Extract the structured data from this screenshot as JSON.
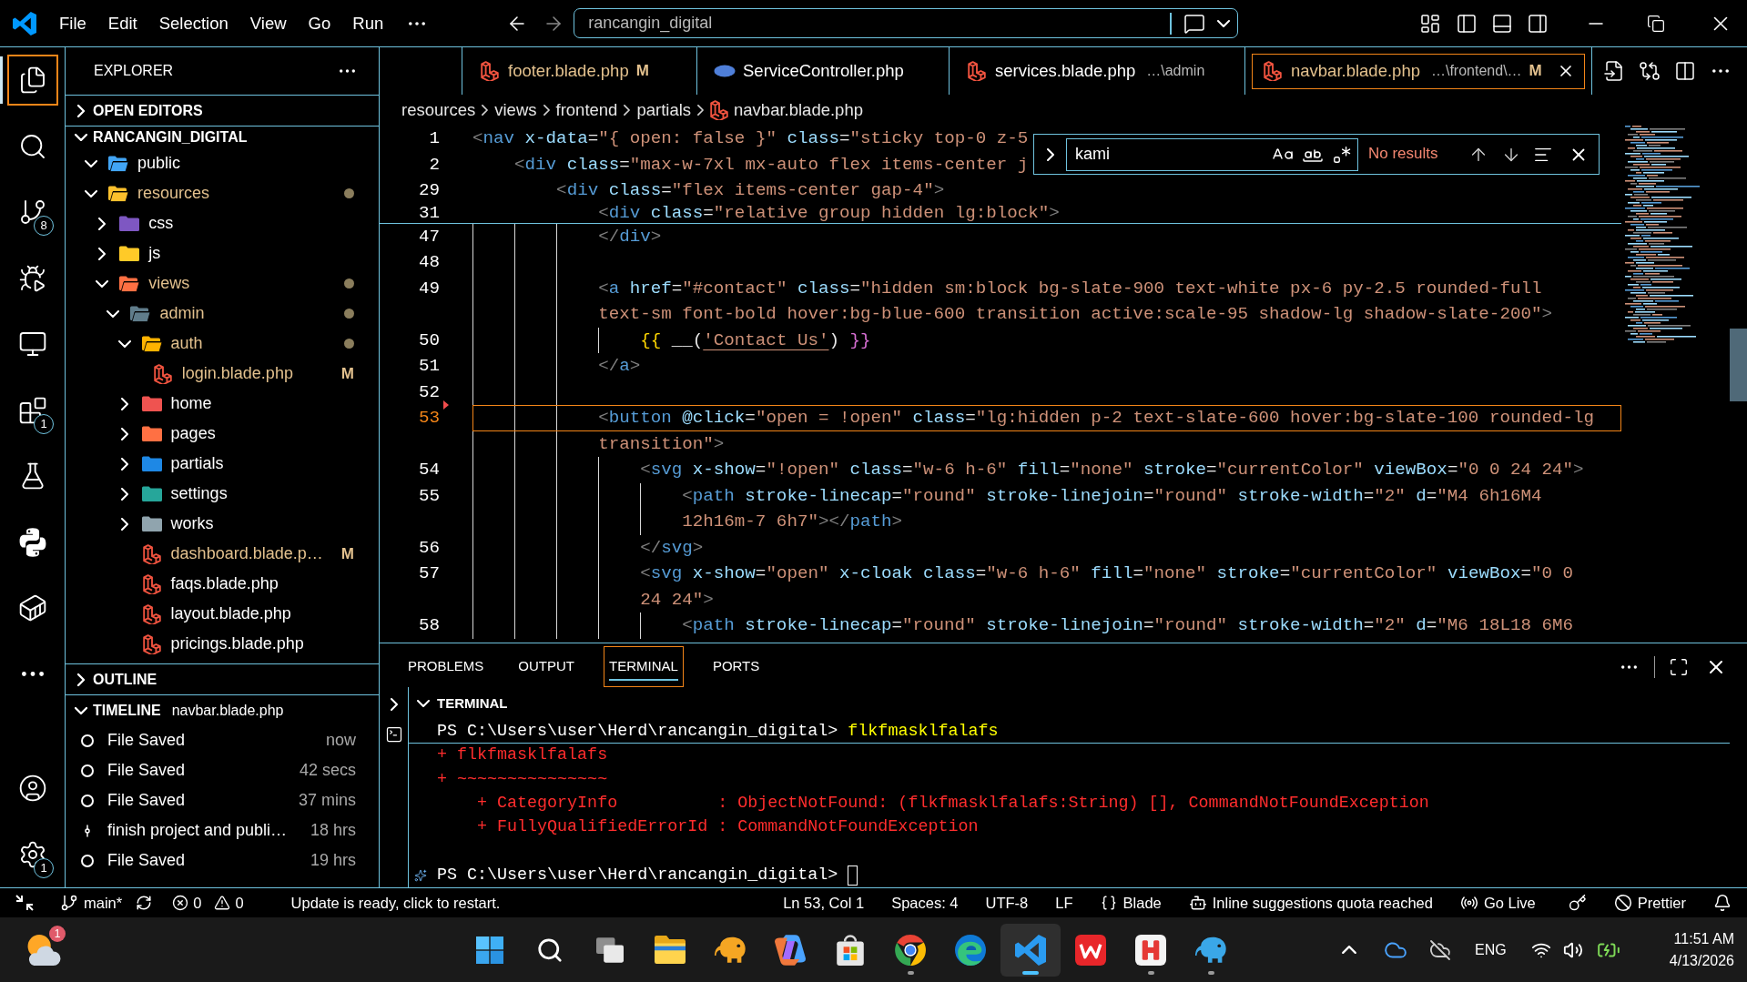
{
  "title_bar": {
    "menu": [
      "File",
      "Edit",
      "Selection",
      "View",
      "Go",
      "Run"
    ],
    "command_center": {
      "value": "rancangin_digital"
    }
  },
  "activity_bar": {
    "top": [
      {
        "kind": "explorer",
        "selected": true
      },
      {
        "kind": "search",
        "selected": false
      },
      {
        "kind": "scm",
        "selected": false,
        "badge": "8"
      },
      {
        "kind": "debug",
        "selected": false
      },
      {
        "kind": "remote",
        "selected": false
      },
      {
        "kind": "extensions",
        "selected": false,
        "badge": "1"
      },
      {
        "kind": "testing",
        "selected": false
      },
      {
        "kind": "python",
        "selected": false
      },
      {
        "kind": "container",
        "selected": false
      },
      {
        "kind": "more",
        "selected": false
      }
    ],
    "bottom": [
      {
        "kind": "accounts",
        "selected": false
      },
      {
        "kind": "manage",
        "selected": false,
        "badge": "1"
      }
    ]
  },
  "sidebar": {
    "title": "EXPLORER",
    "open_editors": {
      "title": "OPEN EDITORS",
      "expanded": false
    },
    "folder": {
      "title": "RANCANGIN_DIGITAL",
      "expanded": true,
      "tree": [
        {
          "name": "public",
          "kind": "folder",
          "color": "#42a5f5",
          "expanded": true,
          "modified": false
        },
        {
          "name": "resources",
          "kind": "folder",
          "color": "#fbc02d",
          "expanded": true,
          "modified": true,
          "children": [
            {
              "name": "css",
              "kind": "folder",
              "color": "#7e57c2",
              "expanded": false,
              "modified": false
            },
            {
              "name": "js",
              "kind": "folder",
              "color": "#ffca28",
              "expanded": false,
              "modified": false
            },
            {
              "name": "views",
              "kind": "folder",
              "color": "#ff7043",
              "expanded": true,
              "modified": true,
              "children": [
                {
                  "name": "admin",
                  "kind": "folder",
                  "color": "#607d8b",
                  "expanded": true,
                  "modified": true,
                  "children": [
                    {
                      "name": "auth",
                      "kind": "folder",
                      "color": "#ffb300",
                      "expanded": true,
                      "modified": true,
                      "children": [
                        {
                          "name": "login.blade.php",
                          "kind": "blade",
                          "modified": true,
                          "badge": "M"
                        }
                      ]
                    },
                    {
                      "name": "home",
                      "kind": "folder",
                      "color": "#ef5350",
                      "expanded": false,
                      "modified": false
                    },
                    {
                      "name": "pages",
                      "kind": "folder",
                      "color": "#ff7043",
                      "expanded": false,
                      "modified": false
                    },
                    {
                      "name": "partials",
                      "kind": "folder",
                      "color": "#1e88e5",
                      "expanded": false,
                      "modified": false
                    },
                    {
                      "name": "settings",
                      "kind": "folder",
                      "color": "#26a69a",
                      "expanded": false,
                      "modified": false
                    },
                    {
                      "name": "works",
                      "kind": "folder",
                      "color": "#90a4ae",
                      "expanded": false,
                      "modified": false
                    },
                    {
                      "name": "dashboard.blade.p…",
                      "kind": "blade",
                      "modified": true,
                      "badge": "M"
                    },
                    {
                      "name": "faqs.blade.php",
                      "kind": "blade",
                      "modified": false
                    },
                    {
                      "name": "layout.blade.php",
                      "kind": "blade",
                      "modified": false
                    },
                    {
                      "name": "pricings.blade.php",
                      "kind": "blade",
                      "modified": false
                    }
                  ]
                }
              ]
            }
          ]
        }
      ]
    },
    "outline": {
      "title": "OUTLINE",
      "expanded": false
    },
    "timeline": {
      "title": "TIMELINE",
      "file": "navbar.blade.php",
      "expanded": true,
      "items": [
        {
          "kind": "save",
          "label": "File Saved",
          "time": "now"
        },
        {
          "kind": "save",
          "label": "File Saved",
          "time": "42 secs"
        },
        {
          "kind": "save",
          "label": "File Saved",
          "time": "37 mins"
        },
        {
          "kind": "commit",
          "label": "finish project and publi…",
          "time": "18 hrs"
        },
        {
          "kind": "save",
          "label": "File Saved",
          "time": "19 hrs"
        }
      ]
    }
  },
  "editor": {
    "tabs": [
      {
        "name": "footer.blade.php",
        "kind": "blade",
        "badge": "M",
        "modified": true,
        "selected": false
      },
      {
        "name": "ServiceController.php",
        "kind": "php",
        "modified": false,
        "selected": false
      },
      {
        "name": "services.blade.php",
        "description": "…\\admin",
        "kind": "blade",
        "modified": false,
        "selected": false
      },
      {
        "name": "navbar.blade.php",
        "description": "…\\frontend\\…",
        "kind": "blade",
        "badge": "M",
        "modified": true,
        "selected": true
      }
    ],
    "breadcrumb": [
      {
        "label": "resources",
        "kind": "folder"
      },
      {
        "label": "views",
        "kind": "folder"
      },
      {
        "label": "frontend",
        "kind": "folder"
      },
      {
        "label": "partials",
        "kind": "folder"
      },
      {
        "label": "navbar.blade.php",
        "kind": "blade"
      }
    ],
    "sticky_lines": [
      {
        "number": "1",
        "text": "<nav x-data=\"{ open: false }\" class=\"sticky top-0 z-5"
      },
      {
        "number": "2",
        "text": "    <div class=\"max-w-7xl mx-auto flex items-center j"
      },
      {
        "number": "29",
        "text": "        <div class=\"flex items-center gap-4\">"
      },
      {
        "number": "31",
        "text": "            <div class=\"relative group hidden lg:block\">"
      }
    ],
    "lines": [
      {
        "number": "47",
        "text": "            </div>",
        "current": false,
        "deleted_above": false
      },
      {
        "number": "48",
        "current": false,
        "deleted_above": false
      },
      {
        "number": "49",
        "text": "            <a href=\"#contact\" class=\"hidden sm:block bg-slate-900 text-white px-6 py-2.5 rounded-full text-sm font-bold hover:bg-blue-600 transition active:scale-95 shadow-lg shadow-slate-200\">",
        "current": false,
        "deleted_above": false
      },
      {
        "number": "50",
        "text": "                {{ __('Contact Us') }}",
        "current": false,
        "deleted_above": false
      },
      {
        "number": "51",
        "text": "            </a>",
        "current": false,
        "deleted_above": false
      },
      {
        "number": "52",
        "current": false,
        "deleted_above": false
      },
      {
        "number": "53",
        "text": "            <button @click=\"open = !open\" class=\"lg:hidden p-2 text-slate-600 hover:bg-slate-100 rounded-lg transition\">",
        "current": true,
        "deleted_above": true
      },
      {
        "number": "54",
        "text": "                <svg x-show=\"!open\" class=\"w-6 h-6\" fill=\"none\" stroke=\"currentColor\" viewBox=\"0 0 24 24\">",
        "current": false,
        "deleted_above": false
      },
      {
        "number": "55",
        "text": "                    <path stroke-linecap=\"round\" stroke-linejoin=\"round\" stroke-width=\"2\" d=\"M4 6h16M4 12h16m-7 6h7\"></path>",
        "current": false,
        "deleted_above": false
      },
      {
        "number": "56",
        "text": "                </svg>",
        "current": false,
        "deleted_above": false
      },
      {
        "number": "57",
        "text": "                <svg x-show=\"open\" x-cloak class=\"w-6 h-6\" fill=\"none\" stroke=\"currentColor\" viewBox=\"0 0 24 24\">",
        "current": false,
        "deleted_above": false
      },
      {
        "number": "58",
        "text": "                    <path stroke-linecap=\"round\" stroke-linejoin=\"round\" stroke-width=\"2\" d=\"M6 18L18 6M6",
        "current": false,
        "deleted_above": false
      }
    ],
    "find": {
      "value": "kami",
      "result": "No results"
    }
  },
  "panel": {
    "tabs": [
      {
        "label": "PROBLEMS",
        "selected": false
      },
      {
        "label": "OUTPUT",
        "selected": false
      },
      {
        "label": "TERMINAL",
        "selected": true
      },
      {
        "label": "PORTS",
        "selected": false
      }
    ],
    "terminal": {
      "title": "TERMINAL",
      "expanded": true,
      "lines": [
        {
          "kind": "prompt",
          "prompt": "PS C:\\Users\\user\\Herd\\rancangin_digital>",
          "command": "flkfmasklfalafs",
          "sticky": true,
          "cursor": false,
          "hint": false
        },
        {
          "kind": "error",
          "text": "+ flkfmasklfalafs"
        },
        {
          "kind": "error",
          "text": "+ ~~~~~~~~~~~~~~~"
        },
        {
          "kind": "error",
          "text": "    + CategoryInfo          : ObjectNotFound: (flkfmasklfalafs:String) [], CommandNotFoundException"
        },
        {
          "kind": "error",
          "text": "    + FullyQualifiedErrorId : CommandNotFoundException"
        },
        {
          "kind": "blank"
        },
        {
          "kind": "prompt",
          "prompt": "PS C:\\Users\\user\\Herd\\rancangin_digital>",
          "sticky": false,
          "cursor": true,
          "hint": true
        }
      ]
    }
  },
  "status_bar": {
    "left": [
      {
        "kind": "remote"
      },
      {
        "kind": "branch",
        "text": "main*"
      },
      {
        "kind": "sync"
      },
      {
        "kind": "problems",
        "errors": "0",
        "warnings": "0"
      },
      {
        "kind": "message",
        "text": "Update is ready, click to restart."
      }
    ],
    "right": [
      {
        "kind": "text",
        "text": "Ln 53, Col 1"
      },
      {
        "kind": "text",
        "text": "Spaces: 4"
      },
      {
        "kind": "text",
        "text": "UTF-8"
      },
      {
        "kind": "text",
        "text": "LF"
      },
      {
        "kind": "language",
        "text": "Blade"
      },
      {
        "kind": "copilot",
        "text": "Inline suggestions quota reached"
      },
      {
        "kind": "live",
        "text": "Go Live"
      },
      {
        "kind": "key"
      },
      {
        "kind": "prettier",
        "text": "Prettier"
      },
      {
        "kind": "bell"
      }
    ]
  },
  "taskbar": {
    "weather": {
      "badge": "1"
    },
    "apps": [
      {
        "kind": "start",
        "running": false,
        "selected": false
      },
      {
        "kind": "search",
        "running": false,
        "selected": false
      },
      {
        "kind": "taskview",
        "running": false,
        "selected": false
      },
      {
        "kind": "files",
        "running": false,
        "selected": false
      },
      {
        "kind": "elephant_orange",
        "running": false,
        "selected": false
      },
      {
        "kind": "swirl",
        "running": false,
        "selected": false
      },
      {
        "kind": "store",
        "running": false,
        "selected": false
      },
      {
        "kind": "chrome",
        "running": true,
        "selected": false
      },
      {
        "kind": "edge",
        "running": false,
        "selected": false
      },
      {
        "kind": "code",
        "running": true,
        "selected": true
      },
      {
        "kind": "wps",
        "running": false,
        "selected": false
      },
      {
        "kind": "herd",
        "running": true,
        "selected": false
      },
      {
        "kind": "elephant_blue",
        "running": true,
        "selected": false
      }
    ],
    "tray": {
      "language": "ENG",
      "time": "11:51 AM",
      "date": "4/13/2026"
    }
  }
}
